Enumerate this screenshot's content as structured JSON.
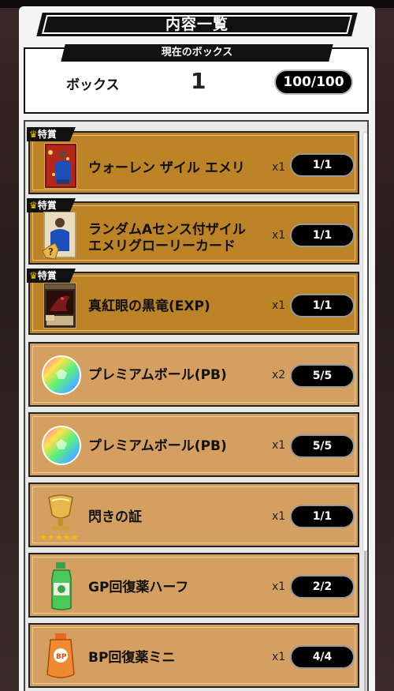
{
  "header": {
    "title": "内容一覧"
  },
  "box": {
    "section_title": "現在のボックス",
    "label": "ボックス",
    "number": "1",
    "count": "100/100"
  },
  "special_badge": "特賞",
  "items": [
    {
      "name": "ウォーレン ザイル エメリ",
      "qty": "x1",
      "progress": "1/1",
      "icon": "player-card-icon",
      "special": true
    },
    {
      "name_line1": "ランダムAセンス付ザイル",
      "name_line2": "エメリグローリーカード",
      "qty": "x1",
      "progress": "1/1",
      "icon": "glory-card-icon",
      "special": true
    },
    {
      "name": "真紅眼の黒竜(EXP)",
      "qty": "x1",
      "progress": "1/1",
      "icon": "dragon-card-icon",
      "special": true
    },
    {
      "name": "プレミアムボール(PB)",
      "qty": "x2",
      "progress": "5/5",
      "icon": "rainbow-ball-icon",
      "special": false
    },
    {
      "name": "プレミアムボール(PB)",
      "qty": "x1",
      "progress": "5/5",
      "icon": "rainbow-ball-icon",
      "special": false
    },
    {
      "name": "閃きの証",
      "qty": "x1",
      "progress": "1/1",
      "icon": "trophy-icon",
      "special": false
    },
    {
      "name": "GP回復薬ハーフ",
      "qty": "x1",
      "progress": "2/2",
      "icon": "green-bottle-icon",
      "special": false
    },
    {
      "name": "BP回復薬ミニ",
      "qty": "x1",
      "progress": "4/4",
      "icon": "orange-pouch-icon",
      "special": false
    }
  ],
  "colors": {
    "special_row": "#bd8327",
    "normal_row": "#d69f62",
    "badge_crown": "#f2c100"
  }
}
